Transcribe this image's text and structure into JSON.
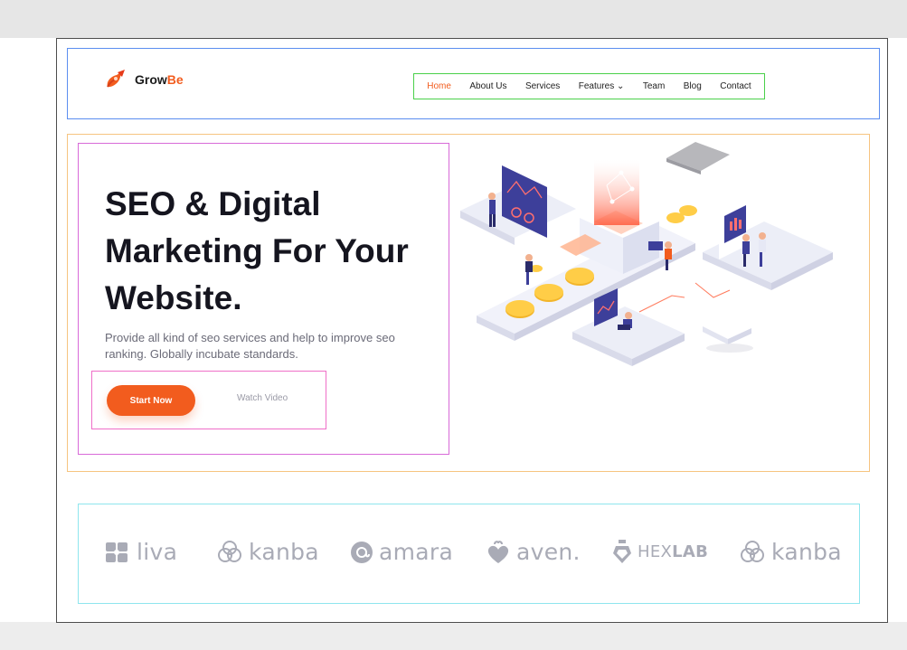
{
  "brand": {
    "name_part1": "Grow",
    "name_part2": "Be",
    "accent_color": "#f25c1e",
    "logo_icon": "rocket-icon"
  },
  "nav": {
    "items": [
      {
        "label": "Home",
        "active": true
      },
      {
        "label": "About Us"
      },
      {
        "label": "Services"
      },
      {
        "label": "Features ⌄"
      },
      {
        "label": "Team"
      },
      {
        "label": "Blog"
      },
      {
        "label": "Contact"
      }
    ]
  },
  "hero": {
    "title_line1": "SEO & Digital",
    "title_line2": "Marketing For Your",
    "title_line3": "Website.",
    "description": "Provide all kind of seo services and help to improve seo ranking. Globally incubate standards.",
    "primary_button": "Start Now",
    "secondary_button": "Watch Video",
    "illustration": "isometric-seo-illustration"
  },
  "partners": {
    "logos": [
      {
        "name": "liva",
        "icon": "puzzle-icon"
      },
      {
        "name": "kanba",
        "icon": "knot-icon"
      },
      {
        "name": "amara",
        "icon": "at-icon"
      },
      {
        "name": "aven.",
        "icon": "leaf-heart-icon"
      },
      {
        "name_light": "HEX",
        "name_bold": "LAB",
        "icon": "flask-icon"
      },
      {
        "name": "kanba",
        "icon": "knot-icon"
      }
    ]
  }
}
